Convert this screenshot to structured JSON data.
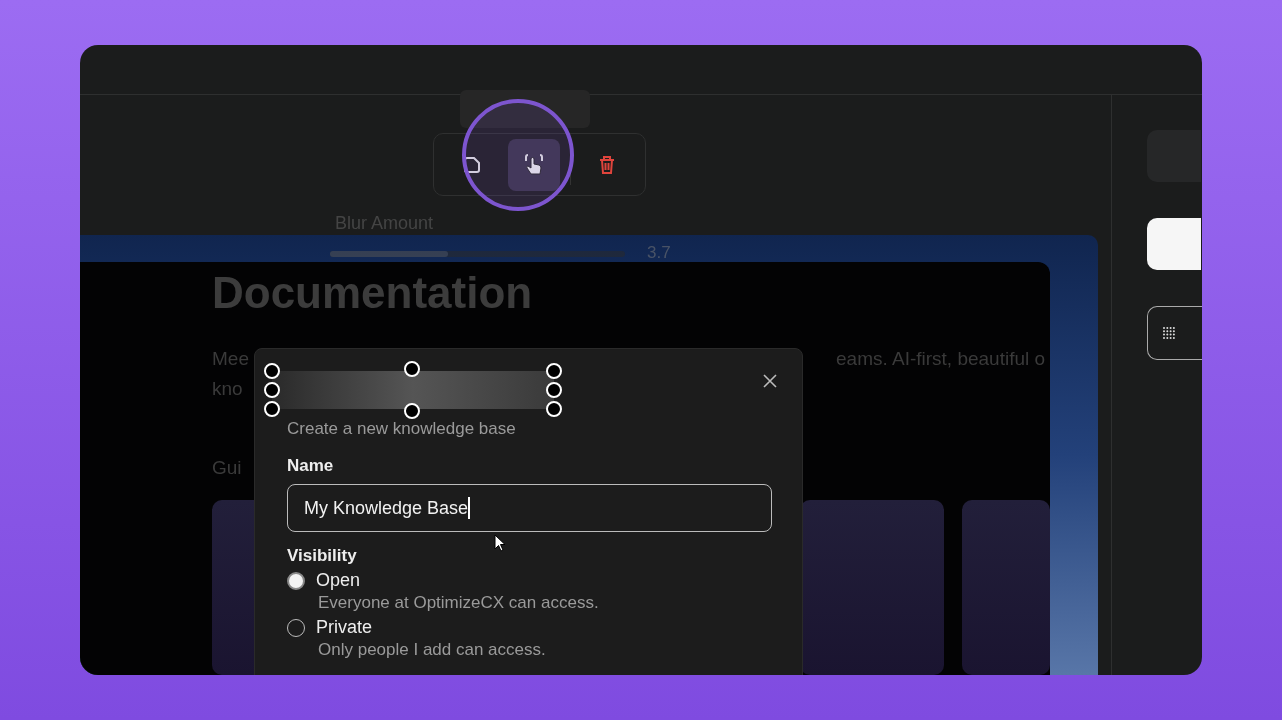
{
  "toolbar": {
    "tools": [
      {
        "kind": "crop",
        "selected": false
      },
      {
        "kind": "pointer",
        "selected": true
      },
      {
        "kind": "delete",
        "selected": false
      }
    ]
  },
  "blur_panel": {
    "label": "Blur Amount",
    "value": "3.7",
    "level": 0.4
  },
  "background_page": {
    "heading": "Documentation",
    "text_left": [
      "Mee",
      "kno"
    ],
    "text_right": "eams. AI-first, beautiful o",
    "section_label": "Gui"
  },
  "dialog": {
    "subtitle": "Create a new knowledge base",
    "name_label": "Name",
    "name_value": "My Knowledge Base",
    "visibility_label": "Visibility",
    "options": [
      {
        "label": "Open",
        "description": "Everyone at OptimizeCX can access.",
        "selected": true
      },
      {
        "label": "Private",
        "description": "Only people I add can access.",
        "selected": false
      }
    ]
  }
}
